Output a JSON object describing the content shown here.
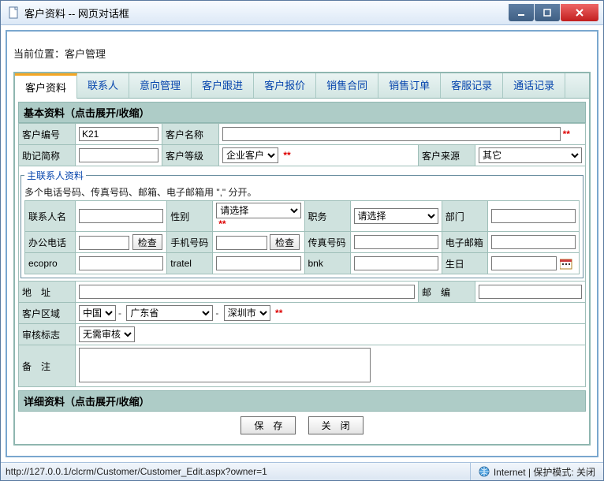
{
  "window": {
    "title": "客户资料 -- 网页对话框"
  },
  "breadcrumb": {
    "label": "当前位置：",
    "value": "客户管理"
  },
  "tabs": [
    {
      "label": "客户资料",
      "active": true
    },
    {
      "label": "联系人"
    },
    {
      "label": "意向管理"
    },
    {
      "label": "客户跟进"
    },
    {
      "label": "客户报价"
    },
    {
      "label": "销售合同"
    },
    {
      "label": "销售订单"
    },
    {
      "label": "客服记录"
    },
    {
      "label": "通话记录"
    }
  ],
  "section_basic": "基本资料（点击展开/收缩）",
  "section_detail": "详细资料（点击展开/收缩）",
  "labels": {
    "cust_no": "客户编号",
    "cust_name": "客户名称",
    "mnemonic": "助记简称",
    "level": "客户等级",
    "source": "客户来源",
    "contact_legend": "主联系人资料",
    "contact_hint": "多个电话号码、传真号码、邮箱、电子邮箱用 \",\" 分开。",
    "contact_name": "联系人名",
    "gender": "性别",
    "position": "职务",
    "dept": "部门",
    "office_phone": "办公电话",
    "check": "检查",
    "mobile": "手机号码",
    "fax": "传真号码",
    "email": "电子邮箱",
    "row3_a": "ecopro",
    "row3_b": "tratel",
    "row3_c": "bnk",
    "birth": "生日",
    "address": "地　址",
    "postcode": "邮　编",
    "region": "客户区域",
    "audit": "审核标志",
    "remark": "备　注"
  },
  "values": {
    "cust_no": "K21",
    "cust_name": "",
    "mnemonic": "",
    "level": "企业客户",
    "source": "其它",
    "contact_name": "",
    "gender": "请选择",
    "position": "请选择",
    "dept": "",
    "office_phone": "",
    "mobile": "",
    "fax": "",
    "email": "",
    "ecopro": "",
    "tratel": "",
    "bnk": "",
    "birth": "",
    "address": "",
    "postcode": "",
    "region_country": "中国",
    "region_province": "广东省",
    "region_city": "深圳市",
    "audit": "无需审核",
    "remark": ""
  },
  "required_mark": "**",
  "buttons": {
    "save": "保　存",
    "close": "关　闭"
  },
  "status": {
    "url": "http://127.0.0.1/clcrm/Customer/Customer_Edit.aspx?owner=1",
    "security": "Internet | 保护模式: 关闭"
  }
}
